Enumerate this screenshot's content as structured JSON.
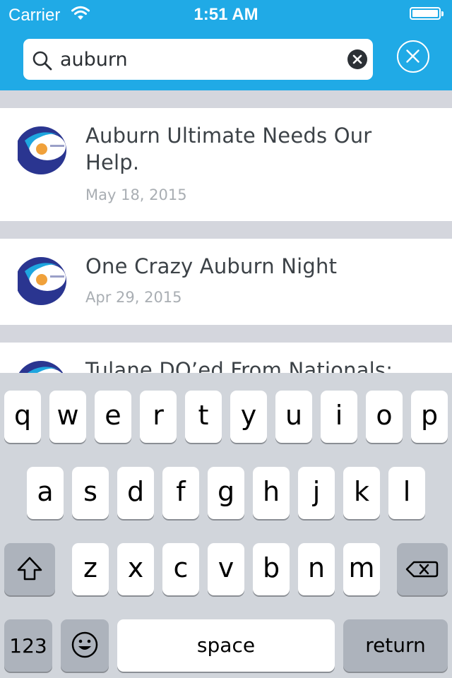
{
  "status_bar": {
    "carrier": "Carrier",
    "time": "1:51 AM",
    "icons": [
      "wifi-icon",
      "battery-icon"
    ]
  },
  "search": {
    "value": "auburn",
    "placeholder": "",
    "icons": [
      "search-icon",
      "clear-icon",
      "cancel-icon"
    ]
  },
  "results": [
    {
      "title": "Auburn Ultimate Needs Our Help.",
      "date": "May 18, 2015"
    },
    {
      "title": "One Crazy Auburn Night",
      "date": "Apr 29, 2015"
    },
    {
      "title": "Tulane DQ’ed From Nationals:",
      "date": ""
    }
  ],
  "keyboard": {
    "row1": [
      "q",
      "w",
      "e",
      "r",
      "t",
      "y",
      "u",
      "i",
      "o",
      "p"
    ],
    "row2": [
      "a",
      "s",
      "d",
      "f",
      "g",
      "h",
      "j",
      "k",
      "l"
    ],
    "row3": [
      "z",
      "x",
      "c",
      "v",
      "b",
      "n",
      "m"
    ],
    "numbers_label": "123",
    "space_label": "space",
    "return_label": "return",
    "icons": [
      "shift-icon",
      "delete-icon",
      "emoji-icon"
    ]
  },
  "colors": {
    "header": "#20aae6",
    "list_background": "#d4d6dd",
    "title_text": "#3c4247",
    "date_text": "#a9aeb3",
    "keyboard_background": "#d1d5db"
  }
}
